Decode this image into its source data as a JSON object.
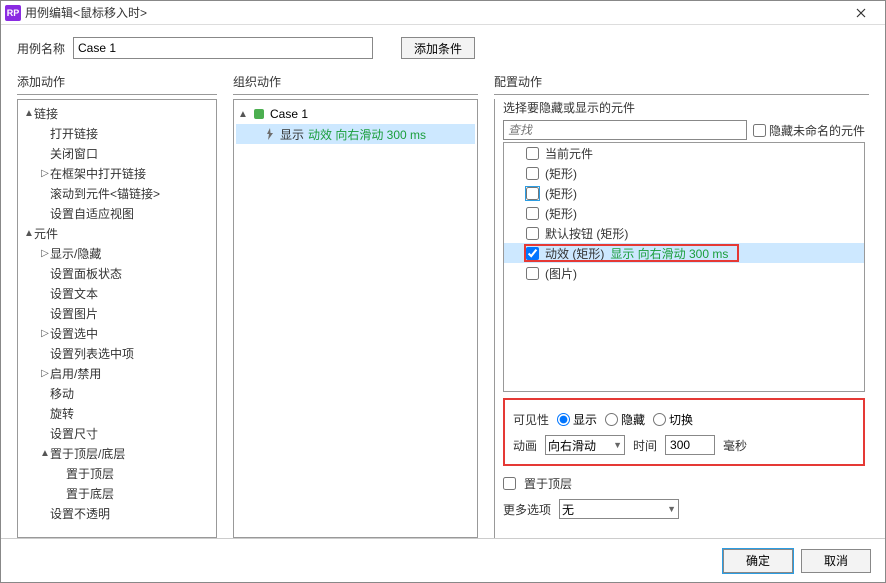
{
  "title": "用例编辑<鼠标移入时>",
  "case_name_label": "用例名称",
  "case_name_value": "Case 1",
  "add_condition_label": "添加条件",
  "panels": {
    "left_title": "添加动作",
    "mid_title": "组织动作",
    "right_title": "配置动作"
  },
  "left_tree": [
    {
      "ind": 0,
      "exp": "▲",
      "label": "链接"
    },
    {
      "ind": 1,
      "exp": "",
      "label": "打开链接"
    },
    {
      "ind": 1,
      "exp": "",
      "label": "关闭窗口"
    },
    {
      "ind": 1,
      "exp": "▷",
      "label": "在框架中打开链接"
    },
    {
      "ind": 1,
      "exp": "",
      "label": "滚动到元件<锚链接>"
    },
    {
      "ind": 1,
      "exp": "",
      "label": "设置自适应视图"
    },
    {
      "ind": 0,
      "exp": "▲",
      "label": "元件"
    },
    {
      "ind": 1,
      "exp": "▷",
      "label": "显示/隐藏"
    },
    {
      "ind": 1,
      "exp": "",
      "label": "设置面板状态"
    },
    {
      "ind": 1,
      "exp": "",
      "label": "设置文本"
    },
    {
      "ind": 1,
      "exp": "",
      "label": "设置图片"
    },
    {
      "ind": 1,
      "exp": "▷",
      "label": "设置选中"
    },
    {
      "ind": 1,
      "exp": "",
      "label": "设置列表选中项"
    },
    {
      "ind": 1,
      "exp": "▷",
      "label": "启用/禁用"
    },
    {
      "ind": 1,
      "exp": "",
      "label": "移动"
    },
    {
      "ind": 1,
      "exp": "",
      "label": "旋转"
    },
    {
      "ind": 1,
      "exp": "",
      "label": "设置尺寸"
    },
    {
      "ind": 1,
      "exp": "▲",
      "label": "置于顶层/底层"
    },
    {
      "ind": 2,
      "exp": "",
      "label": "置于顶层"
    },
    {
      "ind": 2,
      "exp": "",
      "label": "置于底层"
    },
    {
      "ind": 1,
      "exp": "",
      "label": "设置不透明"
    }
  ],
  "mid_tree": {
    "case_label": "Case 1",
    "action_prefix": "显示",
    "action_green": "动效 向右滑动 300 ms"
  },
  "right": {
    "select_label": "选择要隐藏或显示的元件",
    "search_placeholder": "查找",
    "hide_unnamed_label": "隐藏未命名的元件",
    "items": [
      {
        "label": "当前元件",
        "checked": false
      },
      {
        "label": "(矩形)",
        "checked": false
      },
      {
        "label": "(矩形)",
        "checked": false,
        "blue": true
      },
      {
        "label": "(矩形)",
        "checked": false
      },
      {
        "label": "默认按钮 (矩形)",
        "checked": false
      },
      {
        "label": "动效 (矩形)",
        "checked": true,
        "selected": true,
        "extra": "显示 向右滑动 300 ms"
      },
      {
        "label": "(图片)",
        "checked": false
      }
    ],
    "visibility_label": "可见性",
    "vis_options": {
      "show": "显示",
      "hide": "隐藏",
      "toggle": "切换"
    },
    "anim_label": "动画",
    "anim_value": "向右滑动",
    "time_label": "时间",
    "time_value": "300",
    "ms_label": "毫秒",
    "bring_front_label": "置于顶层",
    "more_options_label": "更多选项",
    "more_options_value": "无"
  },
  "footer": {
    "ok": "确定",
    "cancel": "取消"
  }
}
